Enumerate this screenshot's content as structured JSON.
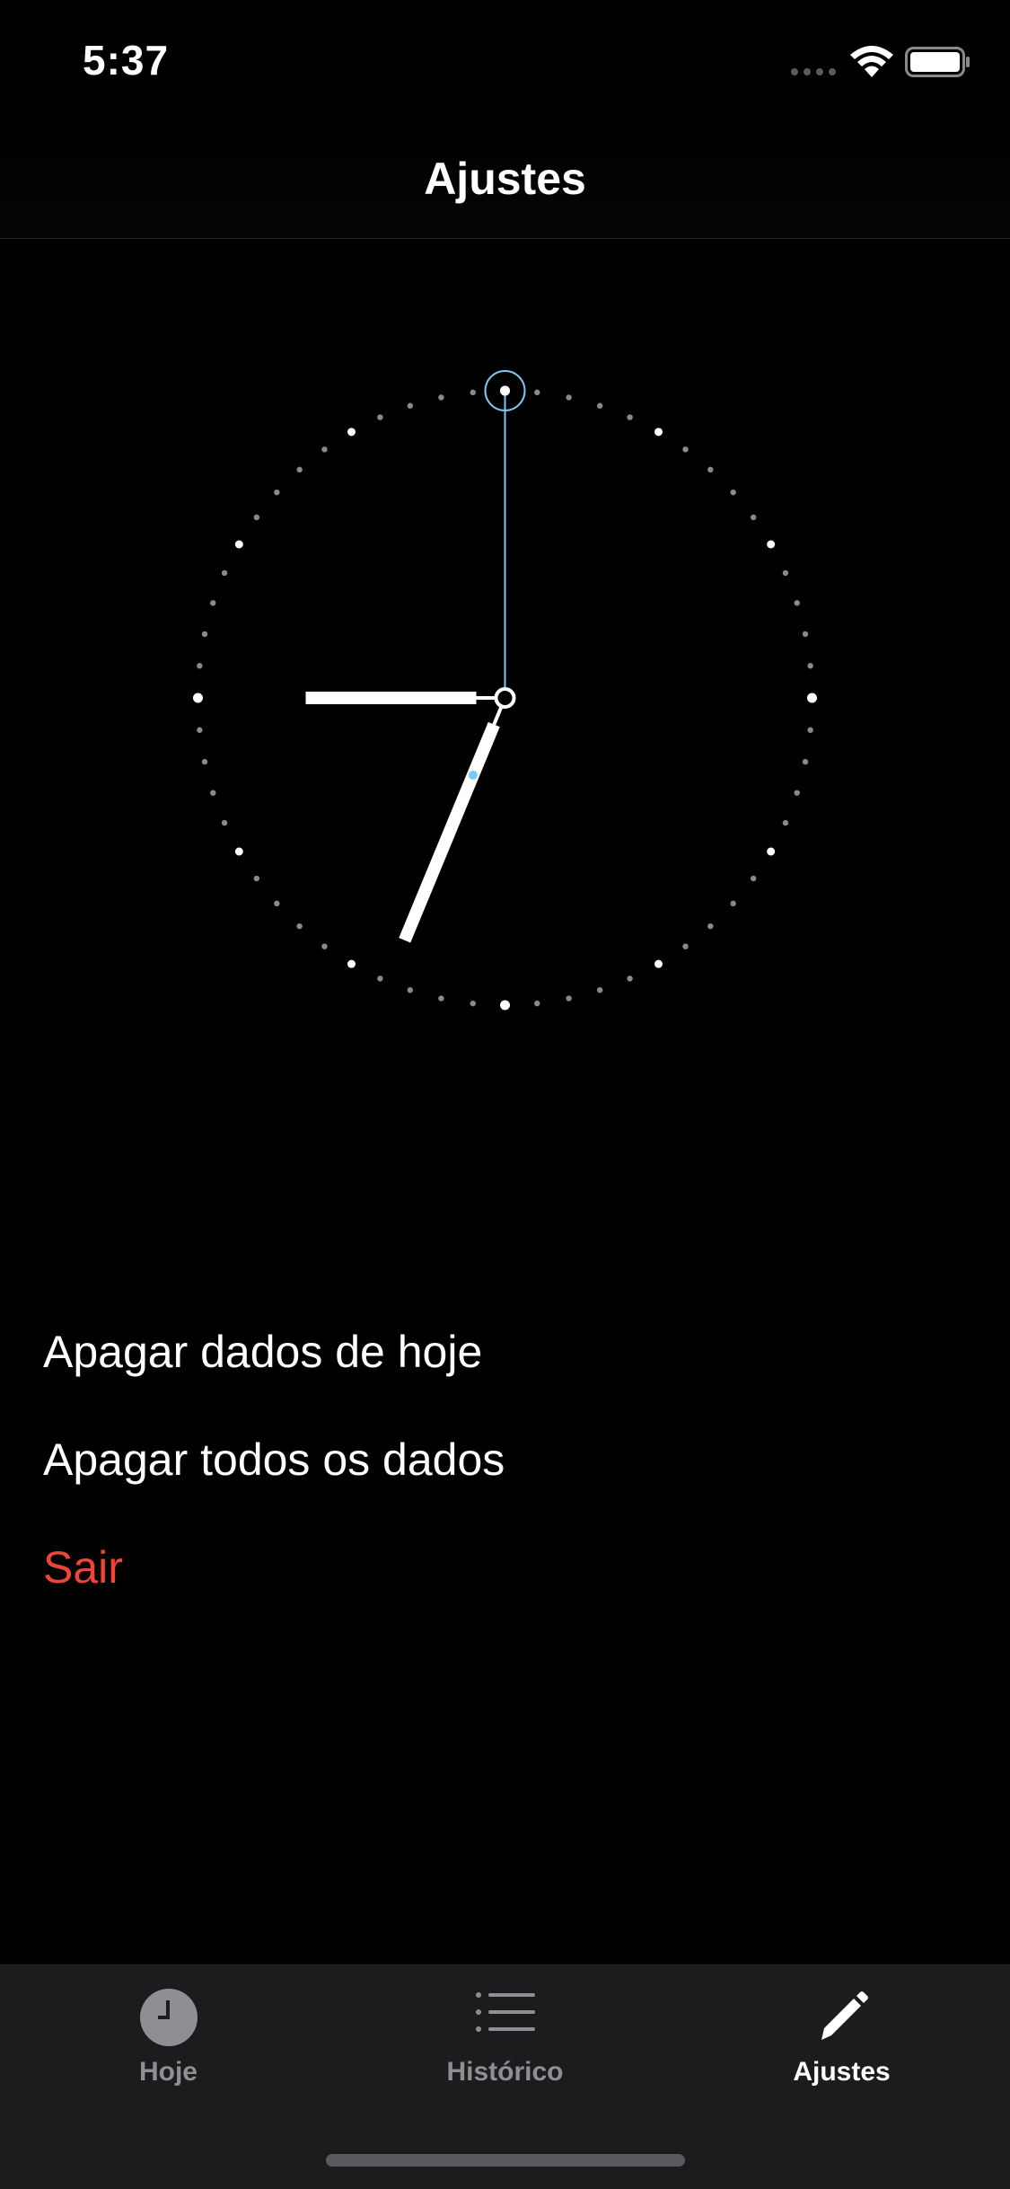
{
  "status_bar": {
    "time": "5:37"
  },
  "nav": {
    "title": "Ajustes"
  },
  "clock": {
    "hour": 6,
    "minute": 45,
    "selected_minute": 0,
    "colors": {
      "hand": "#ffffff",
      "accent": "#7cc8f2",
      "tick_minor": "#8a8a8a",
      "tick_major": "#ffffff"
    }
  },
  "menu": {
    "items": [
      {
        "label": "Apagar dados de hoje"
      },
      {
        "label": "Apagar todos os dados"
      },
      {
        "label": "Sair",
        "color": "#f04438"
      }
    ]
  },
  "tab_bar": {
    "tabs": [
      {
        "label": "Hoje",
        "icon": "clock-icon",
        "active": false
      },
      {
        "label": "Histórico",
        "icon": "list-icon",
        "active": false
      },
      {
        "label": "Ajustes",
        "icon": "pencil-icon",
        "active": true
      }
    ]
  }
}
